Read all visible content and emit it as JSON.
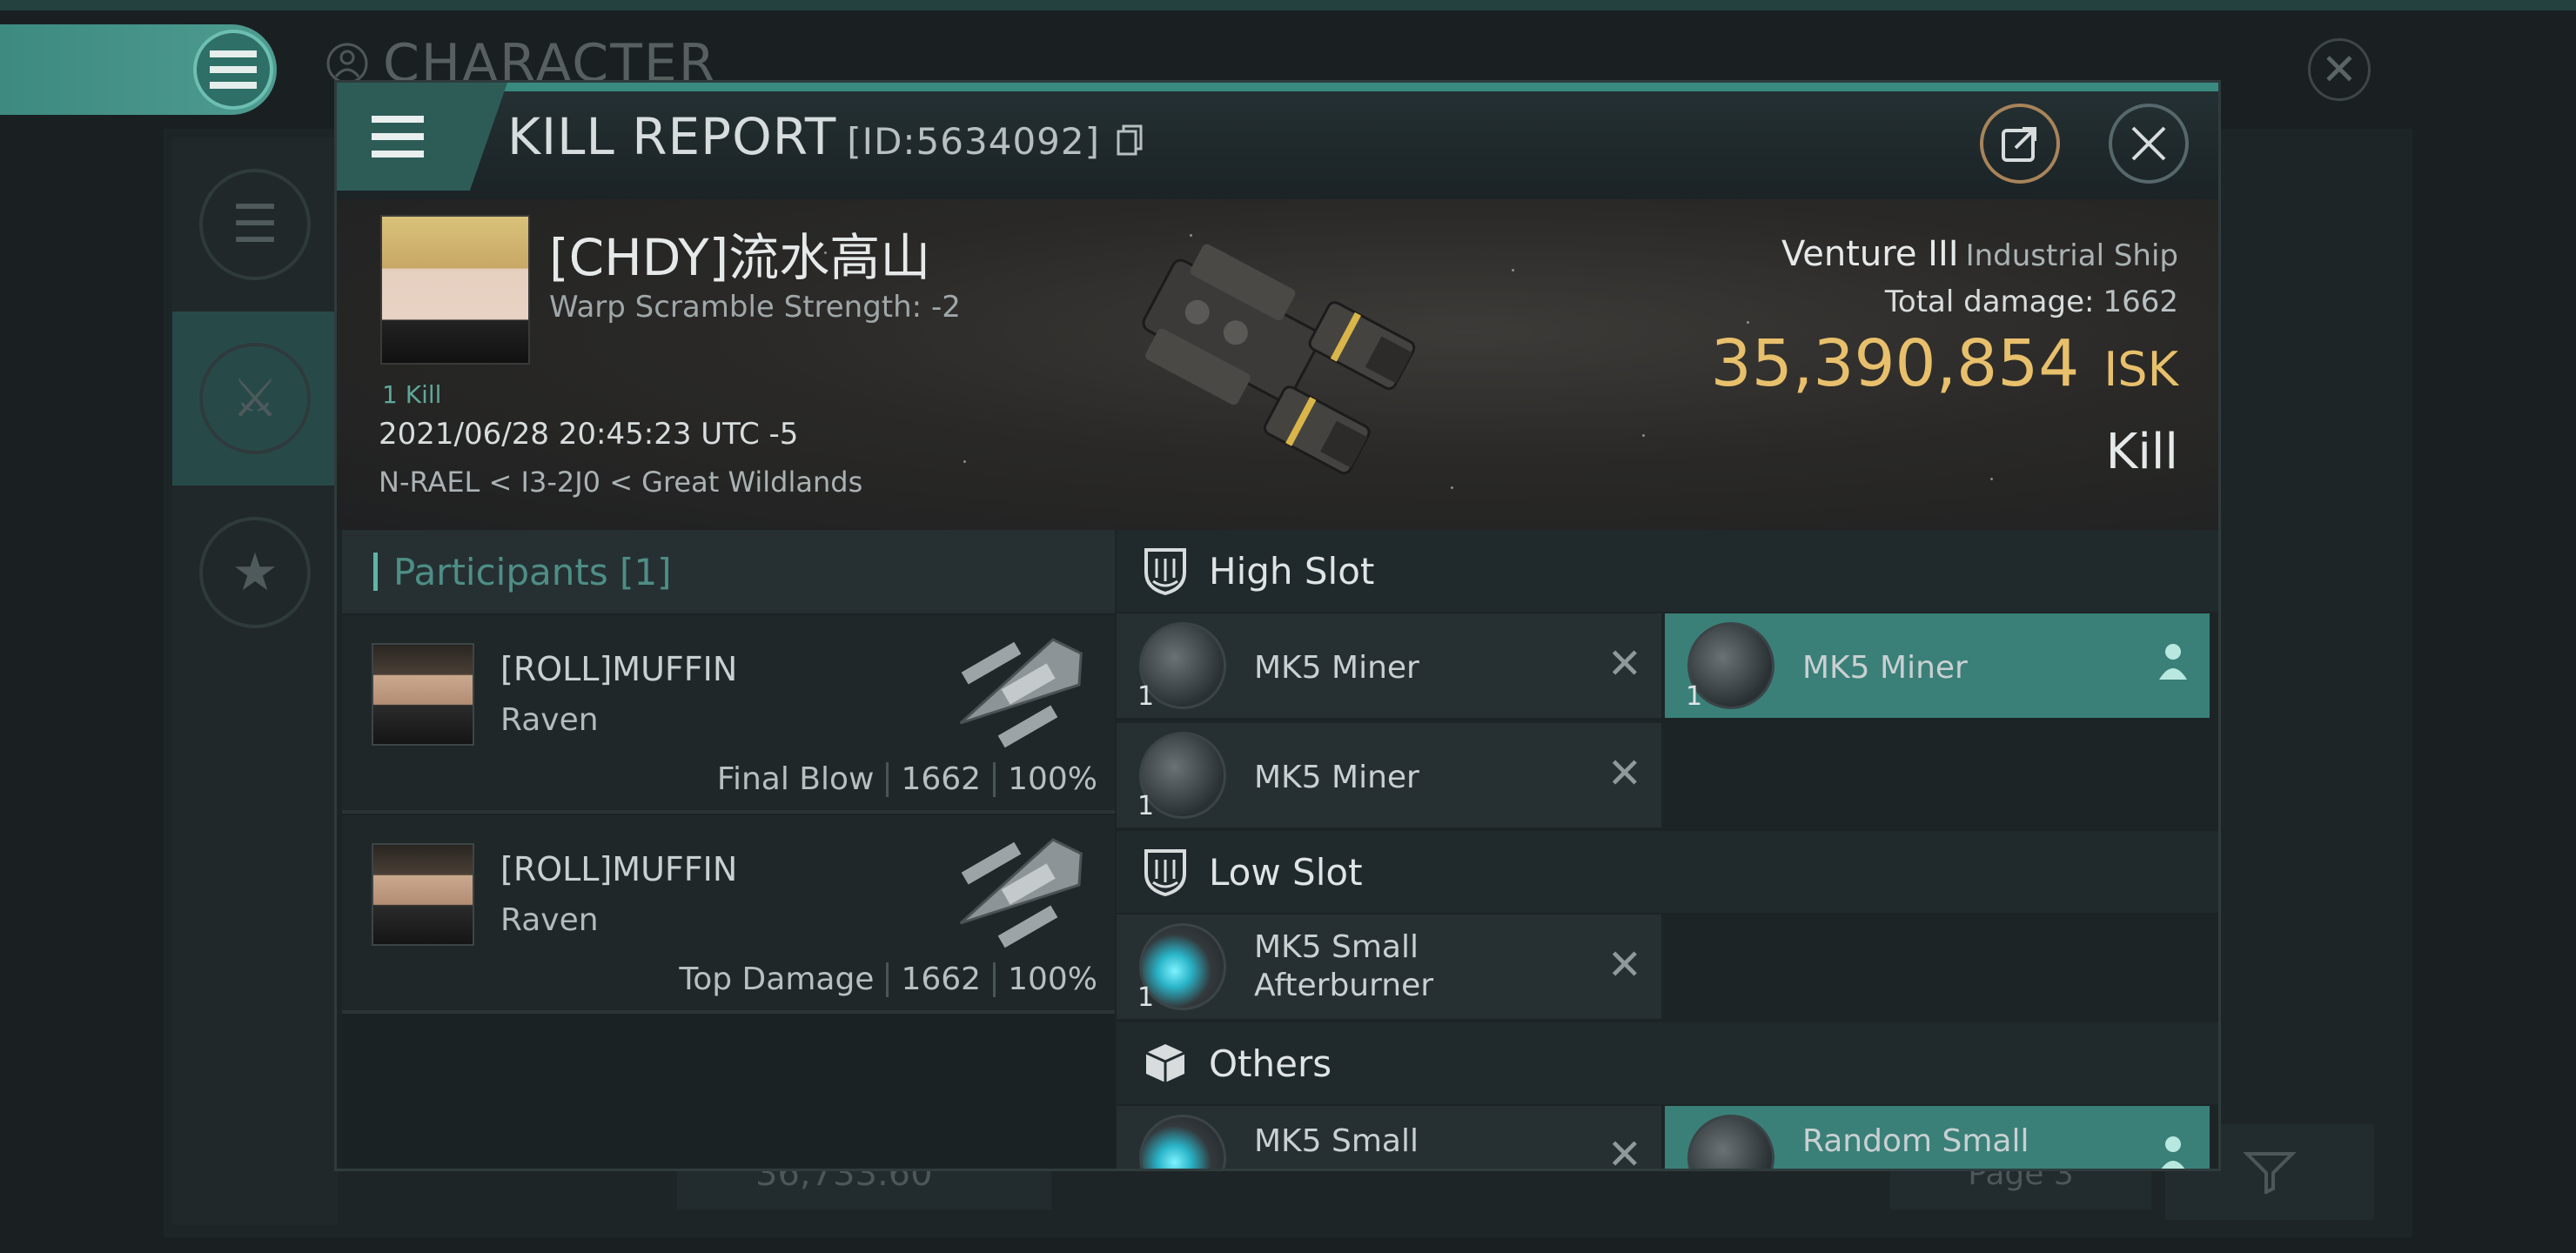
{
  "background": {
    "title": "CHARACTER",
    "bottom_field_value": "36,733.60",
    "page_label": "Page 3"
  },
  "window": {
    "title": "KILL REPORT",
    "report_id": "[ID:5634092]"
  },
  "victim": {
    "name": "[CHDY]流水高山",
    "warp_scramble": "Warp Scramble Strength: -2",
    "kill_count": "1 Kill",
    "datetime": "2021/06/28 20:45:23 UTC -5",
    "location": "N-RAEL < I3-2J0 < Great Wildlands",
    "ship_name": "Venture III",
    "ship_class": "Industrial Ship",
    "total_damage_label": "Total damage:",
    "total_damage": "1662",
    "isk_value": "35,390,854",
    "isk_unit": "ISK",
    "result": "Kill"
  },
  "participants": {
    "header": "Participants [1]",
    "rows": [
      {
        "name": "[ROLL]MUFFIN",
        "ship": "Raven",
        "role": "Final Blow",
        "damage": "1662",
        "percent": "100%"
      },
      {
        "name": "[ROLL]MUFFIN",
        "ship": "Raven",
        "role": "Top Damage",
        "damage": "1662",
        "percent": "100%"
      }
    ]
  },
  "fitting": {
    "high_slot": {
      "label": "High Slot",
      "modules": [
        {
          "name": "MK5 Miner",
          "qty": "1",
          "status": "destroyed"
        },
        {
          "name": "MK5 Miner",
          "qty": "1",
          "status": "dropped"
        },
        {
          "name": "MK5 Miner",
          "qty": "1",
          "status": "destroyed"
        }
      ]
    },
    "low_slot": {
      "label": "Low Slot",
      "modules": [
        {
          "name": "MK5 Small Afterburner",
          "qty": "1",
          "status": "destroyed"
        }
      ]
    },
    "others": {
      "label": "Others",
      "modules": [
        {
          "name": "MK5 Small",
          "status": "destroyed"
        },
        {
          "name": "Random Small",
          "status": "dropped"
        }
      ]
    }
  },
  "colors": {
    "accent": "#3a8a80",
    "isk": "#e8c06c",
    "dropped_highlight": "#3a8078"
  }
}
